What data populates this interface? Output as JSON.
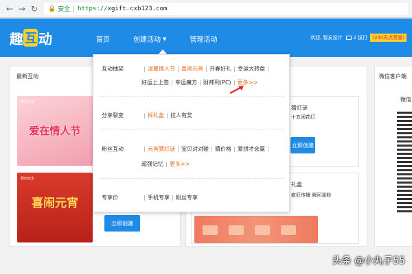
{
  "browser": {
    "secure_label": "安全",
    "url_scheme": "https://",
    "url_host": "xgift.cxb123.com"
  },
  "header": {
    "logo_text_1": "趣",
    "logo_text_2": "互",
    "logo_text_3": "动",
    "nav": [
      {
        "label": "首页"
      },
      {
        "label": "创建活动"
      },
      {
        "label": "管理活动"
      }
    ],
    "user_greeting": "欢迎, 智友设计",
    "messages_label": "2 拔打",
    "days_badge": "(344天点赞量)",
    "accent": "#1e8be6"
  },
  "left_panel": {
    "title": "最新互动",
    "card_pink_tag": "我的双击",
    "card_pink_text": "爱在情人节",
    "card_red_tag": "我的双击",
    "card_red_text": "喜闹元宵",
    "create_button": "立即创建"
  },
  "middle_panel": {
    "title_1": "猜灯谜",
    "subtitle_1": "十五闹花灯",
    "create_button": "立即创建",
    "title_2": "礼盒",
    "subtitle_2": "疯狂传播 瞬间涨粉"
  },
  "right_panel": {
    "title": "微信客户端",
    "sub": "微信"
  },
  "dropdown": {
    "groups": [
      {
        "label": "互动抽奖",
        "line1": [
          "温馨情人节",
          "喜闹元宵",
          "开春好礼",
          "幸运大转盘"
        ],
        "line2": [
          "好运上上签",
          "幸运魔方",
          "财神到(PC)"
        ],
        "more": "更多>>"
      },
      {
        "label": "分享裂变",
        "line1": [
          "拆礼盒",
          "拉人有奖"
        ]
      },
      {
        "label": "粉丝互动",
        "line1": [
          "元宵猜灯谜",
          "宝贝对对碰",
          "猜价格",
          "爱拼才会赢"
        ],
        "line2": [
          "超强记忆"
        ],
        "more": "更多>>"
      },
      {
        "label": "专享价",
        "line1": [
          "手机专享",
          "粉丝专享"
        ]
      }
    ]
  },
  "watermark": "头条 @小丸子55"
}
